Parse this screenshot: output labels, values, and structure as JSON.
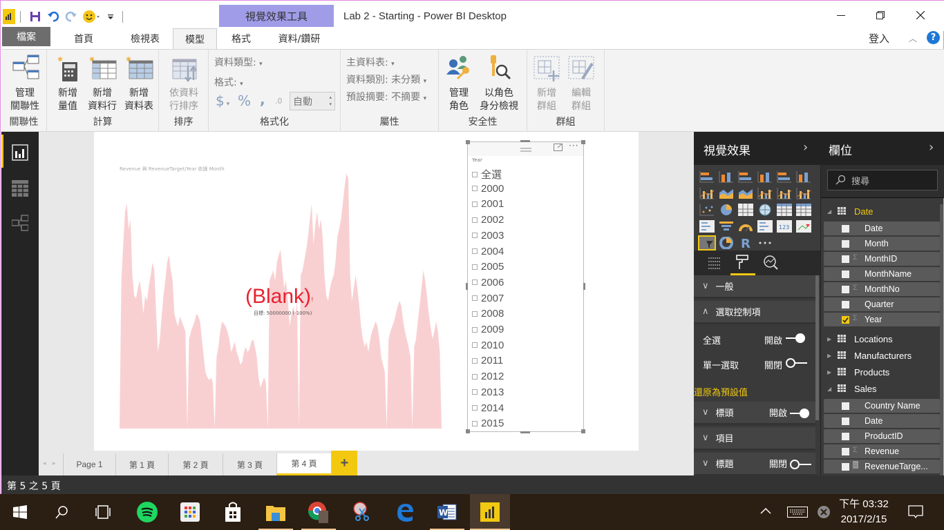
{
  "window": {
    "title": "Lab 2 - Starting - Power BI Desktop",
    "context_tools": "視覺效果工具",
    "signin": "登入",
    "help": "?"
  },
  "quick_access": [
    "save-icon",
    "undo-icon",
    "redo-icon",
    "smiley-feedback-icon",
    "customize-icon"
  ],
  "tabs": [
    {
      "label": "檔案",
      "active": false
    },
    {
      "label": "首頁",
      "active": false
    },
    {
      "label": "檢視表",
      "active": false
    },
    {
      "label": "模型",
      "active": true
    },
    {
      "label": "格式",
      "active": false
    },
    {
      "label": "資料/鑽研",
      "active": false
    }
  ],
  "ribbon": {
    "relationships": {
      "group": "關聯性",
      "manage": [
        "管理",
        "關聯性"
      ]
    },
    "calculations": {
      "group": "計算",
      "new_measure": [
        "新增",
        "量值"
      ],
      "new_column": [
        "新增",
        "資料行"
      ],
      "new_table": [
        "新增",
        "資料表"
      ]
    },
    "sort": {
      "group": "排序",
      "sort_by_column": [
        "依資料",
        "行排序"
      ]
    },
    "formatting": {
      "group": "格式化",
      "data_type": "資料類型:",
      "format": "格式:",
      "currency": "$",
      "percent": "%",
      "comma": ",",
      "decimals": ".0",
      "decimal_value": "自動"
    },
    "properties": {
      "group": "屬性",
      "home_table": "主資料表:",
      "data_category": "資料類別: 未分類",
      "default_summarization": "預設摘要: 不摘要"
    },
    "security": {
      "group": "安全性",
      "manage_roles": [
        "管理",
        "角色"
      ],
      "view_as_roles": [
        "以角色",
        "身分檢視"
      ]
    },
    "groups": {
      "group": "群組",
      "new_group": [
        "新增",
        "群組"
      ],
      "edit_group": [
        "編輯",
        "群組"
      ]
    }
  },
  "left_nav": [
    {
      "name": "report-view",
      "active": true
    },
    {
      "name": "data-view",
      "active": false
    },
    {
      "name": "relationships-view",
      "active": false
    }
  ],
  "kpi": {
    "title": "Revenue 與 RevenueTarget/Year 依據 Month",
    "value": "(Blank)",
    "alert": "!",
    "goal": "目標: 50000000 (-100%)",
    "trend_color": "#f9d0d2",
    "value_color": "#e8222f"
  },
  "chart_data": {
    "type": "area",
    "title": "Revenue 與 RevenueTarget/Year 依據 Month",
    "xlabel": "Month",
    "ylabel": "Revenue",
    "note": "KPI trend axis, unlabeled; relative values 0-100 estimated from shape",
    "ylim": [
      0,
      100
    ],
    "values": [
      0,
      58,
      72,
      85,
      88,
      78,
      82,
      60,
      52,
      51,
      55,
      58,
      53,
      45,
      52,
      50,
      56,
      60,
      65,
      62,
      45,
      30,
      35,
      44,
      52,
      58,
      65,
      68,
      62,
      58,
      45,
      42,
      40,
      44,
      42,
      40,
      38,
      0,
      35,
      38,
      40,
      42,
      45,
      44,
      42,
      35,
      28,
      22,
      20,
      19,
      20,
      18,
      0,
      28,
      32,
      38,
      42,
      41,
      40,
      38,
      35,
      30,
      32,
      34,
      30,
      28,
      25,
      26,
      30,
      32,
      30,
      31,
      34,
      35,
      32,
      28,
      20,
      16,
      18,
      20,
      18,
      0,
      58,
      60,
      62,
      58,
      65,
      68,
      70,
      62,
      55,
      58,
      50,
      40,
      45,
      48,
      44,
      50,
      0,
      60,
      62,
      66,
      70,
      75,
      82,
      88,
      72,
      80,
      85,
      78,
      82,
      75,
      60,
      52,
      50,
      55,
      58,
      60,
      65,
      75,
      78,
      82,
      88,
      95,
      100,
      98,
      60,
      50,
      55,
      60,
      55,
      48,
      40,
      35,
      32,
      34,
      30,
      35,
      38,
      40,
      42,
      40,
      35,
      28,
      25,
      22,
      0,
      35,
      38,
      40,
      42,
      45,
      48,
      50,
      48,
      42,
      38,
      35,
      32,
      28,
      0,
      32,
      35,
      42,
      48,
      55,
      62,
      58,
      52,
      45,
      40,
      35,
      38,
      42,
      38,
      30,
      0
    ]
  },
  "slicer": {
    "title": "Year",
    "items": [
      "全選",
      "2000",
      "2001",
      "2002",
      "2003",
      "2004",
      "2005",
      "2006",
      "2007",
      "2008",
      "2009",
      "2010",
      "2011",
      "2012",
      "2013",
      "2014",
      "2015"
    ]
  },
  "page_tabs": [
    {
      "label": "Page 1",
      "active": false
    },
    {
      "label": "第 1 頁",
      "active": false
    },
    {
      "label": "第 2 頁",
      "active": false
    },
    {
      "label": "第 3 頁",
      "active": false
    },
    {
      "label": "第 4 頁",
      "active": true
    }
  ],
  "add_page": "+",
  "status": "第 5 之 5 頁",
  "viz_pane": {
    "title": "視覺效果",
    "sections": [
      {
        "label": "一般",
        "expanded": false
      },
      {
        "label": "選取控制項",
        "expanded": true
      }
    ],
    "select_all": {
      "label": "全選",
      "state": "開啟",
      "on": true
    },
    "single_select": {
      "label": "單一選取",
      "state": "關閉",
      "on": false
    },
    "reset": "還原為預設值",
    "header": {
      "label": "標頭",
      "state": "開啟",
      "on": true
    },
    "items": {
      "label": "項目"
    },
    "title_row": {
      "label": "標題",
      "state": "關閉",
      "on": false
    }
  },
  "fields_pane": {
    "title": "欄位",
    "search_placeholder": "搜尋",
    "tables": [
      {
        "name": "Date",
        "expanded": true,
        "highlight": true,
        "fields": [
          {
            "name": "Date",
            "sigma": false,
            "checked": false
          },
          {
            "name": "Month",
            "sigma": false,
            "checked": false
          },
          {
            "name": "MonthID",
            "sigma": true,
            "checked": false
          },
          {
            "name": "MonthName",
            "sigma": false,
            "checked": false
          },
          {
            "name": "MonthNo",
            "sigma": true,
            "checked": false
          },
          {
            "name": "Quarter",
            "sigma": false,
            "checked": false
          },
          {
            "name": "Year",
            "sigma": true,
            "checked": true
          }
        ]
      },
      {
        "name": "Locations",
        "expanded": false
      },
      {
        "name": "Manufacturers",
        "expanded": false
      },
      {
        "name": "Products",
        "expanded": false
      },
      {
        "name": "Sales",
        "expanded": true,
        "fields": [
          {
            "name": "Country Name",
            "sigma": false,
            "checked": false
          },
          {
            "name": "Date",
            "sigma": false,
            "checked": false
          },
          {
            "name": "ProductID",
            "sigma": false,
            "checked": false
          },
          {
            "name": "Revenue",
            "sigma": true,
            "checked": false
          },
          {
            "name": "RevenueTarge...",
            "calc": true,
            "checked": false
          }
        ]
      }
    ]
  },
  "taskbar": {
    "apps": [
      "start",
      "search",
      "task-view",
      "spotify",
      "app-launcher",
      "store",
      "file-explorer",
      "chrome",
      "snipping-tool",
      "edge",
      "word",
      "power-bi"
    ],
    "time": "下午 03:32",
    "date": "2017/2/15"
  }
}
